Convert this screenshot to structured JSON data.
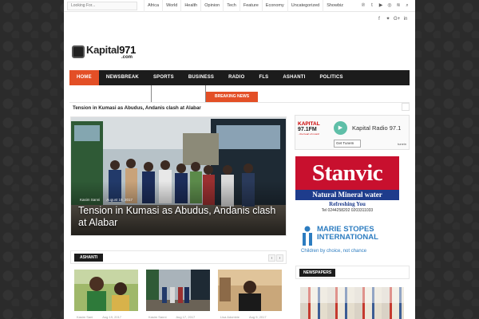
{
  "topbar": {
    "search_placeholder": "Looking For...",
    "menu": [
      "Africa",
      "World",
      "Health",
      "Opinion",
      "Tech",
      "Feature",
      "Economy",
      "Uncategorized",
      "Showbiz"
    ],
    "social_icons": [
      "pinterest-icon",
      "tumblr-icon",
      "youtube-icon",
      "instagram-icon",
      "rss-icon",
      "search-icon"
    ],
    "social_glyphs": [
      "℗",
      "t",
      "▶",
      "◎",
      "≋",
      "⌕"
    ]
  },
  "header": {
    "social_icons": [
      "facebook-icon",
      "twitter-icon",
      "googleplus-icon",
      "linkedin-icon"
    ],
    "social_glyphs": [
      "f",
      "✦",
      "G+",
      "in"
    ],
    "logo_text": "Kapital",
    "logo_number": "971",
    "logo_domain": ".com"
  },
  "nav": {
    "items": [
      "HOME",
      "NEWSBREAK",
      "SPORTS",
      "BUSINESS",
      "RADIO",
      "FLS",
      "ASHANTI",
      "POLITICS"
    ],
    "active": "HOME"
  },
  "breaking": {
    "label": "BREAKING NEWS",
    "headline": "Tension in Kumasi as Abudus, Andanis clash at Alabar"
  },
  "featured": {
    "author": "Kasim Sanni",
    "date": "August 19, 2017",
    "title": "Tension in Kumasi as Abudus, Andanis clash at Alabar"
  },
  "radio": {
    "logo_kapital": "KAPITAL",
    "logo_freq": "97.1FM",
    "logo_tagline": "...the heart of music!",
    "name": "Kapital Radio 97.1",
    "button": "Get TuneIn",
    "brand": "tunein"
  },
  "ads": {
    "stanvic_title": "Stanvic",
    "stanvic_sub": "Natural Mineral water",
    "stanvic_tag": "Refreshing You",
    "stanvic_tel": "Tel 0244258202 0203311033",
    "marie_name_1": "MARIE STOPES",
    "marie_name_2": "INTERNATIONAL",
    "marie_tagline": "Children by choice, not chance"
  },
  "sections": {
    "ashanti_label": "ASHANTI",
    "newspapers_label": "NEWSPAPERS",
    "prev": "‹",
    "next": "›",
    "thumb_meta": [
      {
        "author": "Kasim Sani",
        "date": "Aug 19, 2017"
      },
      {
        "author": "Kasim Sanni",
        "date": "Aug 17, 2017"
      },
      {
        "author": "Lisa Adombie",
        "date": "Aug 9, 2017"
      }
    ]
  },
  "colors": {
    "accent": "#e34f26",
    "nav_bg": "#1c1c1c",
    "stanvic_red": "#c8102e",
    "stanvic_blue": "#1e3c8c",
    "marie_blue": "#2c7cc0",
    "tunein_green": "#5fbfa8"
  }
}
